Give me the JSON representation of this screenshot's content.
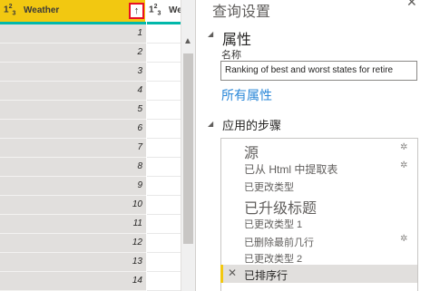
{
  "grid": {
    "column1": {
      "type_icon": "1²₃",
      "title": "Weather",
      "sort_icon": "↑"
    },
    "column2": {
      "type_icon": "1²₃",
      "title": "Wellness"
    },
    "rows": [
      "1",
      "2",
      "3",
      "4",
      "5",
      "6",
      "7",
      "8",
      "9",
      "10",
      "11",
      "12",
      "13",
      "14"
    ],
    "colors": {
      "header": "#f2c811",
      "quality_bar": "#01b8aa",
      "sort_outline": "#e81123",
      "row_fill": "#e1dfdd"
    }
  },
  "scrollbar": {
    "up_icon": "▲"
  },
  "pane": {
    "title": "查询设置",
    "close_icon": "✕",
    "properties": {
      "toggle_icon": "◢",
      "title": "属性",
      "name_label": "名称",
      "name_value": "Ranking of best and worst states for retire",
      "all_properties_link": "所有属性"
    },
    "steps": {
      "toggle_icon": "◢",
      "title": "应用的步骤",
      "items": [
        {
          "label": "源",
          "gear": true
        },
        {
          "label": "已从 Html 中提取表",
          "gear": true
        },
        {
          "label": "已更改类型",
          "gear": false
        },
        {
          "label": "已升级标题",
          "gear": false
        },
        {
          "label": "已更改类型 1",
          "gear": false
        },
        {
          "label": "已删除最前几行",
          "gear": true
        },
        {
          "label": "已更改类型 2",
          "gear": false
        },
        {
          "label": "已排序行",
          "gear": false,
          "selected": true
        }
      ],
      "gear_icon": "✲",
      "delete_icon": "✕",
      "selected_color": "#e1dfdd",
      "marker_color": "#f2c811"
    }
  }
}
